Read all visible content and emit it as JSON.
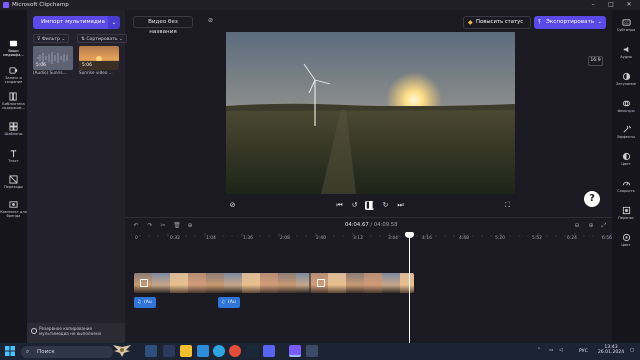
{
  "window": {
    "title": "Microsoft Clipchamp"
  },
  "left_nav": {
    "items": [
      {
        "label": "Ваши медиафа...",
        "icon": "media-icon"
      },
      {
        "label": "Запись и создание",
        "icon": "record-icon"
      },
      {
        "label": "Библиотека содержим...",
        "icon": "library-icon"
      },
      {
        "label": "Шаблоны",
        "icon": "templates-icon"
      },
      {
        "label": "Текст",
        "icon": "text-icon"
      },
      {
        "label": "Переходы",
        "icon": "transitions-icon"
      },
      {
        "label": "Комплект для бренда",
        "icon": "brand-icon"
      }
    ]
  },
  "media_panel": {
    "import_label": "Импорт мультимедиа",
    "filter_label": "Фильтр",
    "sort_label": "Сортировать",
    "items": [
      {
        "duration": "5:06",
        "caption": "(Audio) Sunris..."
      },
      {
        "duration": "5:06",
        "caption": "Sunrise video ..."
      }
    ],
    "backup_text": "Резервное копирование мультимедиа не выполнено"
  },
  "header": {
    "project_name": "Видео без названия",
    "upgrade_label": "Повысить статус",
    "export_label": "Экспортировать"
  },
  "preview": {
    "aspect_ratio": "16:9"
  },
  "help": {
    "label": "?"
  },
  "right_nav": {
    "items": [
      {
        "label": "Субтитры",
        "icon": "captions-icon"
      },
      {
        "label": "Аудио",
        "icon": "audio-icon"
      },
      {
        "label": "Затухание",
        "icon": "fade-icon"
      },
      {
        "label": "Фильтры",
        "icon": "filters-icon"
      },
      {
        "label": "Эффекты",
        "icon": "effects-icon"
      },
      {
        "label": "Цвет",
        "icon": "color-icon"
      },
      {
        "label": "Скорость",
        "icon": "speed-icon"
      },
      {
        "label": "Перенос",
        "icon": "transform-icon"
      },
      {
        "label": "Цвет",
        "icon": "color2-icon"
      }
    ]
  },
  "timeline": {
    "current_time": "04:04.67",
    "total_time": "/ 04:09.58",
    "ticks": [
      "0",
      "0:32",
      "1:04",
      "1:36",
      "2:08",
      "2:40",
      "3:12",
      "3:44",
      "4:16",
      "4:48",
      "5:20",
      "5:52",
      "6:24",
      "6:56"
    ],
    "audio_clips": [
      {
        "label": "(Au"
      },
      {
        "label": "(Au"
      }
    ]
  },
  "taskbar": {
    "search_placeholder": "Поиск",
    "language": "РУС",
    "time": "13:43",
    "date": "26.01.2024"
  }
}
